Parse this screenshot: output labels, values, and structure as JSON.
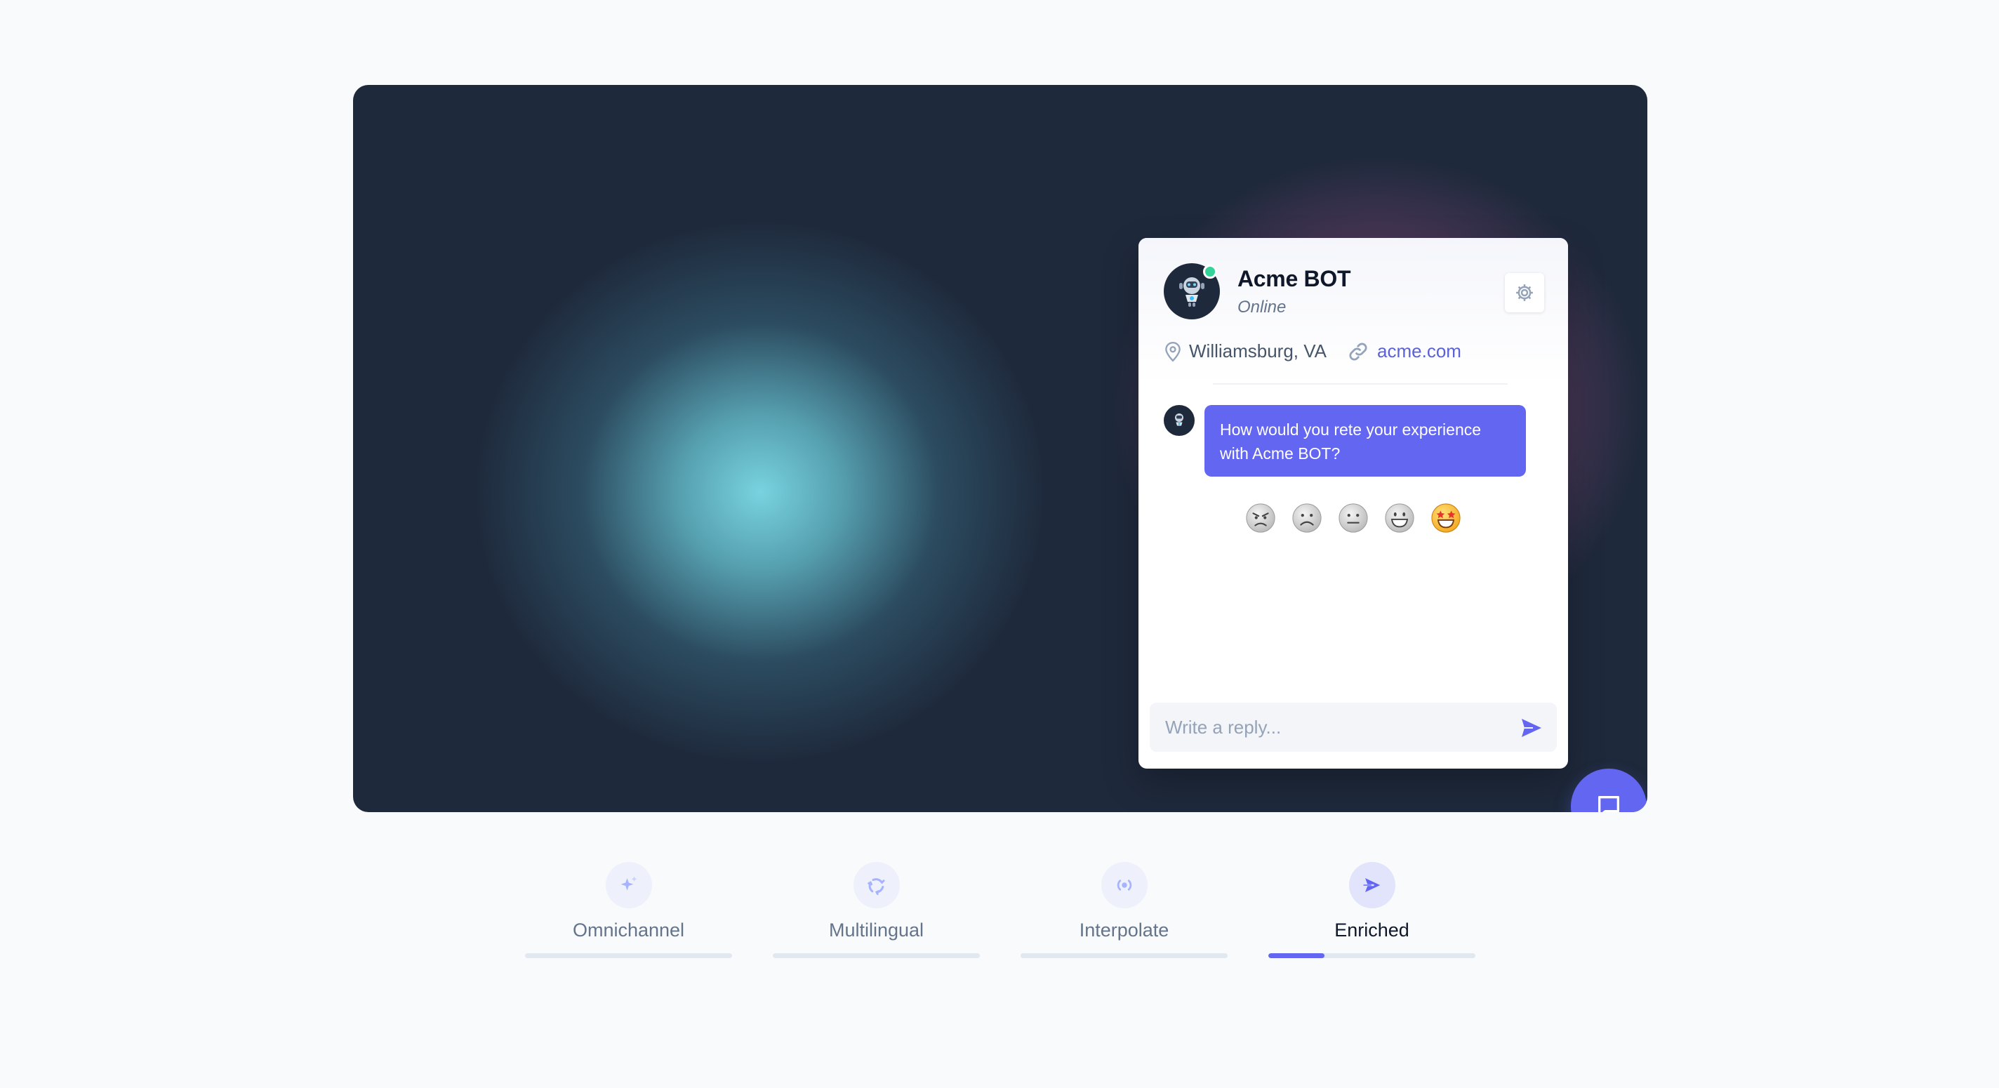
{
  "chat": {
    "bot_name": "Acme BOT",
    "status": "Online",
    "location": "Williamsburg, VA",
    "website": "acme.com",
    "message": "How would you rete your experience with Acme BOT?",
    "ratings": [
      "angry-face",
      "frowning-face",
      "neutral-face",
      "grinning-face",
      "star-struck-face"
    ],
    "reply_placeholder": "Write a reply...",
    "icons": {
      "avatar": "robot-avatar-icon",
      "settings": "gear-icon",
      "location": "map-pin-icon",
      "link": "link-icon",
      "send": "send-icon",
      "fab": "chat-bubble-icon"
    }
  },
  "tabs": [
    {
      "label": "Omnichannel",
      "icon": "sparkles-icon",
      "progress": 0
    },
    {
      "label": "Multilingual",
      "icon": "recycle-icon",
      "progress": 0
    },
    {
      "label": "Interpolate",
      "icon": "broadcast-icon",
      "progress": 0
    },
    {
      "label": "Enriched",
      "icon": "paper-plane-icon",
      "progress": 0.27,
      "active": true
    }
  ],
  "colors": {
    "accent": "#6366f1",
    "stage_bg": "#1e293b",
    "online": "#34d399",
    "page_bg": "#f8fafc"
  }
}
